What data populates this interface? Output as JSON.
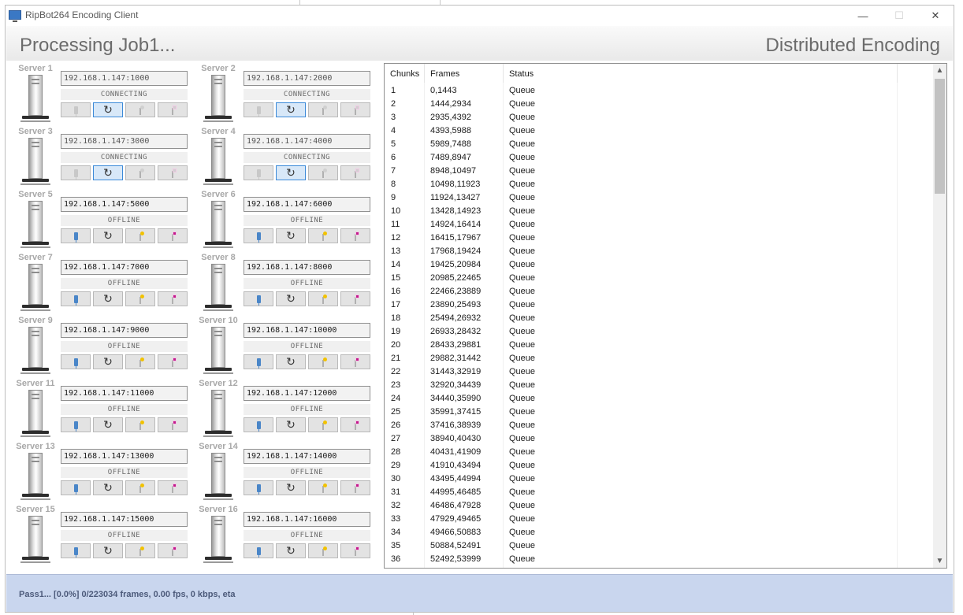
{
  "window": {
    "title": "RipBot264 Encoding Client"
  },
  "header": {
    "left": "Processing Job1...",
    "right": "Distributed Encoding"
  },
  "servers": [
    {
      "label": "Server 1",
      "ip": "192.168.1.147:1000",
      "state": "CONNECTING"
    },
    {
      "label": "Server 2",
      "ip": "192.168.1.147:2000",
      "state": "CONNECTING"
    },
    {
      "label": "Server 3",
      "ip": "192.168.1.147:3000",
      "state": "CONNECTING"
    },
    {
      "label": "Server 4",
      "ip": "192.168.1.147:4000",
      "state": "CONNECTING"
    },
    {
      "label": "Server 5",
      "ip": "192.168.1.147:5000",
      "state": "OFFLINE"
    },
    {
      "label": "Server 6",
      "ip": "192.168.1.147:6000",
      "state": "OFFLINE"
    },
    {
      "label": "Server 7",
      "ip": "192.168.1.147:7000",
      "state": "OFFLINE"
    },
    {
      "label": "Server 8",
      "ip": "192.168.1.147:8000",
      "state": "OFFLINE"
    },
    {
      "label": "Server 9",
      "ip": "192.168.1.147:9000",
      "state": "OFFLINE"
    },
    {
      "label": "Server 10",
      "ip": "192.168.1.147:10000",
      "state": "OFFLINE"
    },
    {
      "label": "Server 11",
      "ip": "192.168.1.147:11000",
      "state": "OFFLINE"
    },
    {
      "label": "Server 12",
      "ip": "192.168.1.147:12000",
      "state": "OFFLINE"
    },
    {
      "label": "Server 13",
      "ip": "192.168.1.147:13000",
      "state": "OFFLINE"
    },
    {
      "label": "Server 14",
      "ip": "192.168.1.147:14000",
      "state": "OFFLINE"
    },
    {
      "label": "Server 15",
      "ip": "192.168.1.147:15000",
      "state": "OFFLINE"
    },
    {
      "label": "Server 16",
      "ip": "192.168.1.147:16000",
      "state": "OFFLINE"
    }
  ],
  "table": {
    "columns": [
      "Chunks",
      "Frames",
      "Status"
    ],
    "rows": [
      [
        "1",
        "0,1443",
        "Queue"
      ],
      [
        "2",
        "1444,2934",
        "Queue"
      ],
      [
        "3",
        "2935,4392",
        "Queue"
      ],
      [
        "4",
        "4393,5988",
        "Queue"
      ],
      [
        "5",
        "5989,7488",
        "Queue"
      ],
      [
        "6",
        "7489,8947",
        "Queue"
      ],
      [
        "7",
        "8948,10497",
        "Queue"
      ],
      [
        "8",
        "10498,11923",
        "Queue"
      ],
      [
        "9",
        "11924,13427",
        "Queue"
      ],
      [
        "10",
        "13428,14923",
        "Queue"
      ],
      [
        "11",
        "14924,16414",
        "Queue"
      ],
      [
        "12",
        "16415,17967",
        "Queue"
      ],
      [
        "13",
        "17968,19424",
        "Queue"
      ],
      [
        "14",
        "19425,20984",
        "Queue"
      ],
      [
        "15",
        "20985,22465",
        "Queue"
      ],
      [
        "16",
        "22466,23889",
        "Queue"
      ],
      [
        "17",
        "23890,25493",
        "Queue"
      ],
      [
        "18",
        "25494,26932",
        "Queue"
      ],
      [
        "19",
        "26933,28432",
        "Queue"
      ],
      [
        "20",
        "28433,29881",
        "Queue"
      ],
      [
        "21",
        "29882,31442",
        "Queue"
      ],
      [
        "22",
        "31443,32919",
        "Queue"
      ],
      [
        "23",
        "32920,34439",
        "Queue"
      ],
      [
        "24",
        "34440,35990",
        "Queue"
      ],
      [
        "25",
        "35991,37415",
        "Queue"
      ],
      [
        "26",
        "37416,38939",
        "Queue"
      ],
      [
        "27",
        "38940,40430",
        "Queue"
      ],
      [
        "28",
        "40431,41909",
        "Queue"
      ],
      [
        "29",
        "41910,43494",
        "Queue"
      ],
      [
        "30",
        "43495,44994",
        "Queue"
      ],
      [
        "31",
        "44995,46485",
        "Queue"
      ],
      [
        "32",
        "46486,47928",
        "Queue"
      ],
      [
        "33",
        "47929,49465",
        "Queue"
      ],
      [
        "34",
        "49466,50883",
        "Queue"
      ],
      [
        "35",
        "50884,52491",
        "Queue"
      ],
      [
        "36",
        "52492,53999",
        "Queue"
      ]
    ]
  },
  "status": {
    "text": "Pass1... [0.0%] 0/223034 frames, 0.00 fps, 0 kbps, eta"
  },
  "icons": {
    "app": "monitor-icon",
    "minimize": "minimize-icon",
    "maximize": "maximize-icon",
    "close": "close-icon",
    "connect": "plug-icon",
    "refresh": "refresh-icon",
    "power": "bulb-icon",
    "shutdown": "shutdown-icon",
    "scroll_up": "chevron-up-icon",
    "scroll_down": "chevron-down-icon"
  },
  "colors": {
    "status_bar": "#c9d6ee",
    "selected_button": "#d8e8f8",
    "accent_blue": "#3c8ad8"
  }
}
